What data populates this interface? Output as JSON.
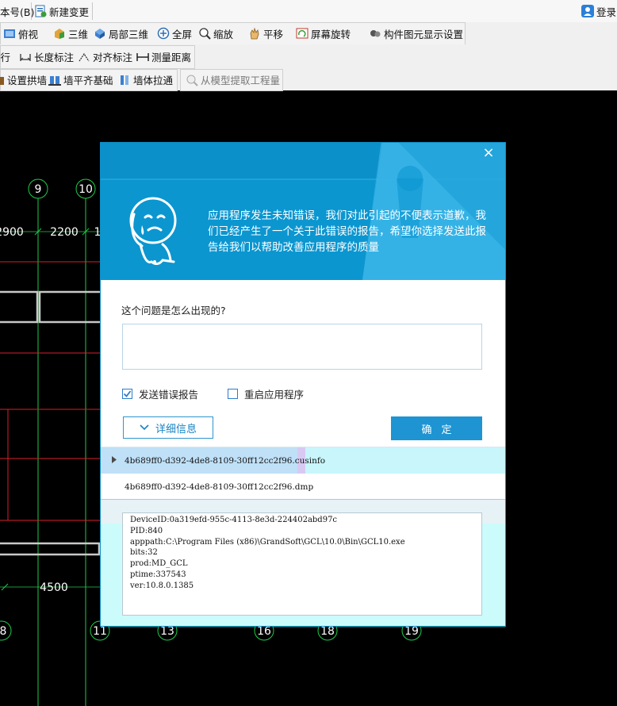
{
  "toolbar1": {
    "items": [
      "本号(B)",
      "新建变更"
    ],
    "login_label": "登录"
  },
  "toolbar2": {
    "items": [
      "俯视",
      "三维",
      "局部三维",
      "全屏",
      "缩放",
      "平移",
      "屏幕旋转",
      "构件图元显示设置"
    ]
  },
  "toolbar3": {
    "items": [
      "平行",
      "长度标注",
      "对齐标注",
      "测量距离"
    ]
  },
  "toolbar4": {
    "items": [
      "设置拱墙",
      "墙平齐基础",
      "墙体拉通",
      "从模型提取工程量"
    ]
  },
  "canvas": {
    "axis_top": [
      "9",
      "10"
    ],
    "axis_bottom": [
      "8",
      "11",
      "13",
      "16",
      "18",
      "19"
    ],
    "dims": [
      "2900",
      "2200",
      "1",
      "4500"
    ]
  },
  "dialog": {
    "close_symbol": "×",
    "message": "应用程序发生未知错误，我们对此引起的不便表示道歉，我们已经产生了一个关于此错误的报告，希望你选择发送此报告给我们以帮助改善应用程序的质量",
    "question_label": "这个问题是怎么出现的?",
    "question_value": "",
    "send_report_label": "发送错误报告",
    "send_report_checked": true,
    "restart_label": "重启应用程序",
    "restart_checked": false,
    "details_button": "详细信息",
    "ok_button": "确定",
    "files": [
      "4b689ff0-d392-4de8-8109-30ff12cc2f96.cusinfo",
      "4b689ff0-d392-4de8-8109-30ff12cc2f96.dmp"
    ],
    "details_lines": [
      "DeviceID:0a319efd-955c-4113-8e3d-224402abd97c",
      "PID:840",
      "apppath:C:\\Program Files (x86)\\GrandSoft\\GCL\\10.0\\Bin\\GCL10.exe",
      "bits:32",
      "prod:MD_GCL",
      "ptime:337543",
      "ver:10.8.0.1385"
    ]
  },
  "colors": {
    "header_blue": "#0b96d0",
    "button_blue": "#1e94d2",
    "selected_row": "#c8f6fb",
    "details_bg": "#ccfbfc",
    "axis_green": "#1fcc4a",
    "cad_red": "#d8202a"
  },
  "icons": [
    "user-icon",
    "new-change-icon",
    "top-view-icon",
    "3d-icon",
    "partial-3d-icon",
    "fullscreen-icon",
    "zoom-icon",
    "pan-icon",
    "rotate-icon",
    "display-settings-icon",
    "length-dim-icon",
    "align-dim-icon",
    "measure-icon",
    "arch-wall-icon",
    "wall-foundation-icon",
    "wall-stretch-icon",
    "extract-qty-icon",
    "close-icon",
    "sad-mascot-icon",
    "chevron-down-icon",
    "expand-arrow-icon"
  ]
}
